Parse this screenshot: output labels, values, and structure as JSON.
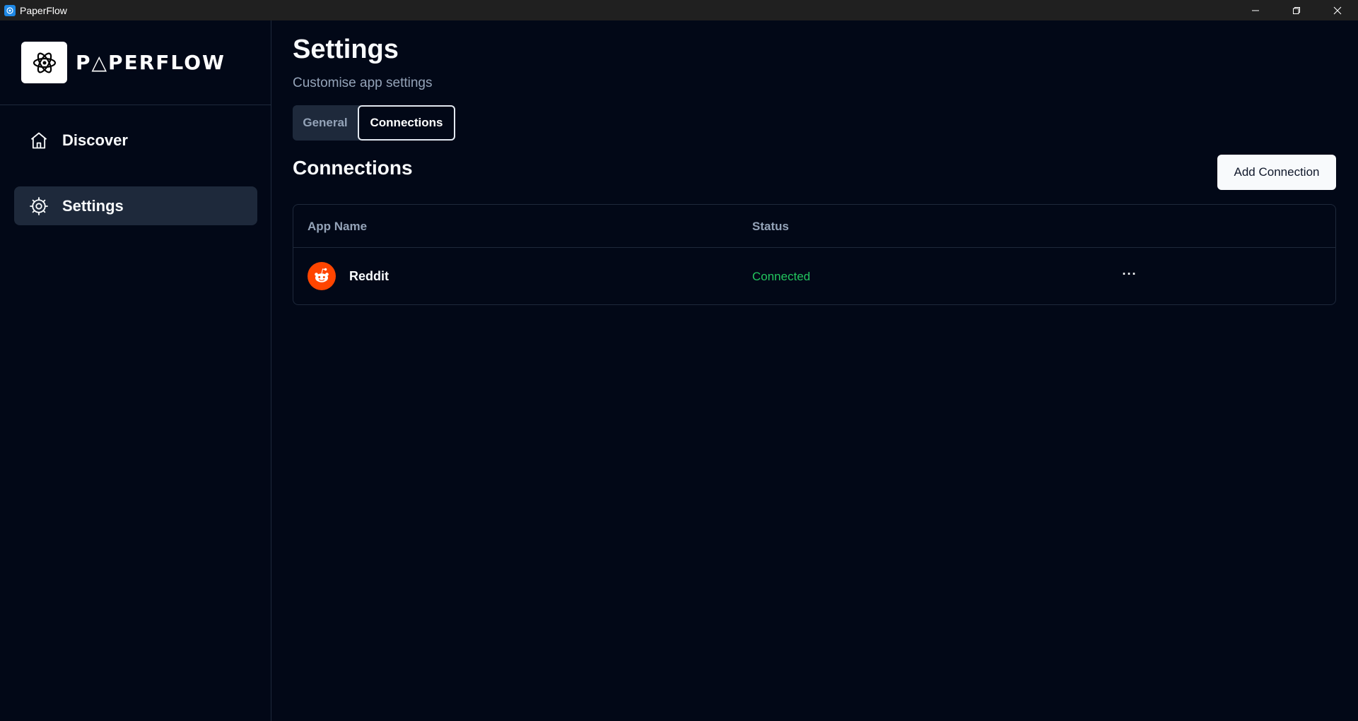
{
  "window": {
    "title": "PaperFlow",
    "controls": [
      "minimize-icon",
      "restore-icon",
      "close-icon"
    ]
  },
  "sidebar": {
    "brand_name": "P△PERFLOW",
    "items": [
      {
        "label": "Discover",
        "icon": "home-icon",
        "active": false
      },
      {
        "label": "Settings",
        "icon": "gear-icon",
        "active": true
      }
    ]
  },
  "main": {
    "title": "Settings",
    "subtitle": "Customise app settings",
    "tabs": [
      {
        "label": "General",
        "active": false
      },
      {
        "label": "Connections",
        "active": true
      }
    ],
    "section_title": "Connections",
    "add_button_label": "Add Connection",
    "table": {
      "headers": [
        "App Name",
        "Status"
      ],
      "rows": [
        {
          "app_name": "Reddit",
          "icon": "reddit-icon",
          "status": "Connected",
          "actions_label": "···"
        }
      ]
    }
  },
  "colors": {
    "background": "#020817",
    "accent_active": "#1e293b",
    "status_connected": "#22c55e",
    "reddit_brand": "#ff4500"
  }
}
